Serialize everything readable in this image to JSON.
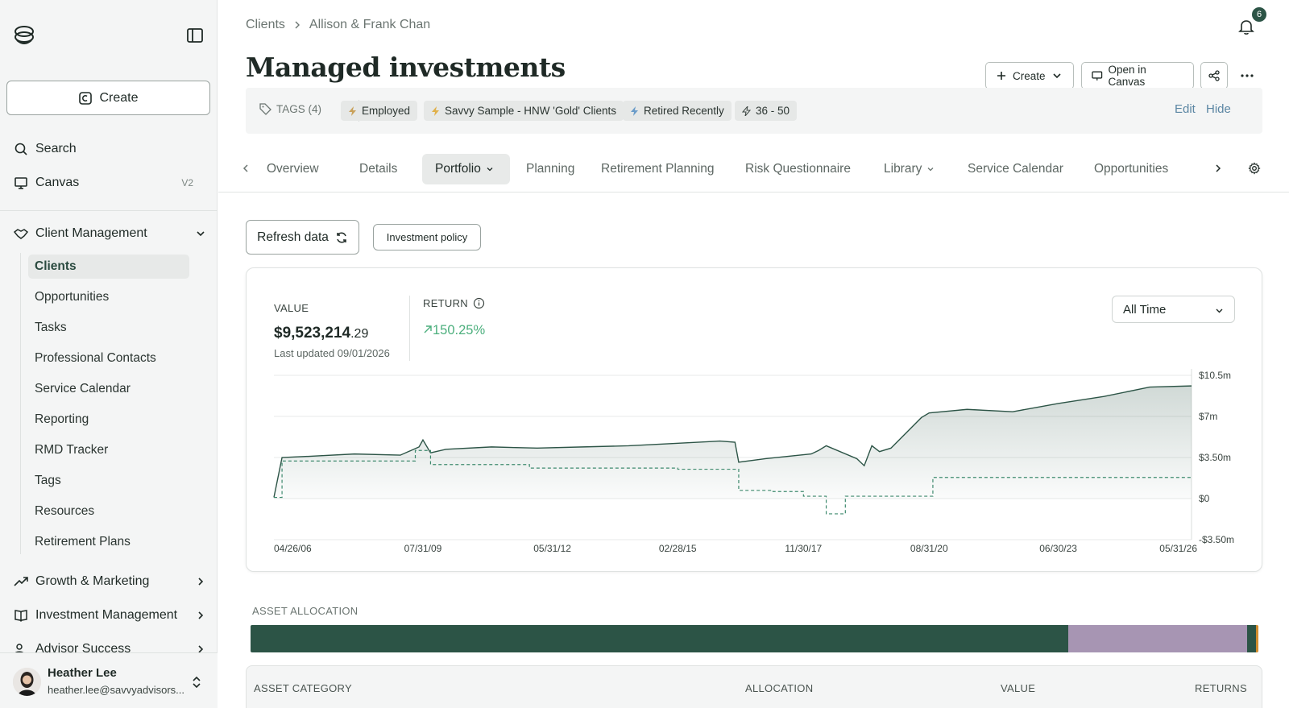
{
  "sidebar": {
    "create_label": "Create",
    "nav": [
      {
        "label": "Search",
        "icon": "search-icon"
      },
      {
        "label": "Canvas",
        "icon": "canvas-icon",
        "badge": "V2"
      }
    ],
    "client_management": {
      "label": "Client Management",
      "items": [
        {
          "label": "Clients",
          "active": true
        },
        {
          "label": "Opportunities"
        },
        {
          "label": "Tasks"
        },
        {
          "label": "Professional Contacts"
        },
        {
          "label": "Service Calendar"
        },
        {
          "label": "Reporting"
        },
        {
          "label": "RMD Tracker"
        },
        {
          "label": "Tags"
        },
        {
          "label": "Resources"
        },
        {
          "label": "Retirement Plans"
        }
      ]
    },
    "sections": [
      {
        "label": "Growth & Marketing",
        "icon": "trend-icon"
      },
      {
        "label": "Investment Management",
        "icon": "book-icon"
      },
      {
        "label": "Advisor Success",
        "icon": "users-icon"
      }
    ],
    "user": {
      "name": "Heather Lee",
      "email": "heather.lee@savvyadvisors..."
    }
  },
  "header": {
    "breadcrumb": [
      "Clients",
      "Allison & Frank Chan"
    ],
    "notifications": "6",
    "title": "Managed investments",
    "buttons": {
      "create": "Create",
      "canvas": "Open in Canvas"
    }
  },
  "tags": {
    "label": "TAGS (4)",
    "items": [
      "Employed",
      "Savvy Sample - HNW 'Gold' Clients",
      "Retired Recently",
      "36 - 50"
    ],
    "edit": "Edit",
    "hide": "Hide"
  },
  "tabs": [
    "Overview",
    "Details",
    "Portfolio",
    "Planning",
    "Retirement Planning",
    "Risk Questionnaire",
    "Library",
    "Service Calendar",
    "Opportunities"
  ],
  "active_tab": "Portfolio",
  "actions": {
    "refresh": "Refresh data",
    "policy": "Investment policy"
  },
  "summary": {
    "value_label": "VALUE",
    "value_main": "$9,523,214",
    "value_cents": ".29",
    "updated": "Last updated 09/01/2026",
    "return_label": "RETURN",
    "return_value": "150.25%",
    "range": "All Time"
  },
  "chart_data": {
    "type": "line",
    "x_ticks": [
      "04/26/06",
      "07/31/09",
      "05/31/12",
      "02/28/15",
      "11/30/17",
      "08/31/20",
      "06/30/23",
      "05/31/26"
    ],
    "y_ticks": [
      "$10.5m",
      "$7m",
      "$3.50m",
      "$0",
      "-$3.50m"
    ],
    "ylim": [
      -3.5,
      10.5
    ],
    "series": [
      {
        "style": "solid",
        "x": [
          "04/26/06",
          "06/30/06",
          "01/31/07",
          "01/31/08",
          "01/31/09",
          "06/30/09",
          "07/31/09",
          "09/30/09",
          "01/31/10",
          "01/31/11",
          "01/31/12",
          "01/31/13",
          "01/31/14",
          "01/31/15",
          "01/31/16",
          "05/31/16",
          "06/30/16",
          "01/31/17",
          "01/31/18",
          "03/31/18",
          "05/31/18",
          "01/31/19",
          "03/31/19",
          "05/31/19",
          "07/31/19",
          "10/31/19",
          "06/30/20",
          "08/31/20",
          "06/30/21",
          "06/30/22",
          "06/30/23",
          "06/30/24",
          "06/30/25",
          "05/31/26"
        ],
        "values": [
          0.1,
          3.5,
          3.6,
          3.8,
          3.7,
          4.4,
          5.0,
          3.9,
          4.2,
          4.4,
          4.3,
          4.4,
          4.5,
          4.7,
          4.9,
          4.8,
          3.1,
          3.4,
          3.8,
          4.1,
          4.5,
          3.4,
          2.8,
          4.5,
          4.0,
          4.3,
          6.9,
          7.3,
          7.6,
          7.4,
          8.1,
          8.7,
          9.5,
          9.6
        ]
      },
      {
        "style": "dashed",
        "x": [
          "04/26/06",
          "06/30/06",
          "03/31/09",
          "05/31/09",
          "09/30/09",
          "11/30/11",
          "02/28/15",
          "05/31/16",
          "06/30/16",
          "03/31/17",
          "11/30/17",
          "05/31/18",
          "10/31/18",
          "11/30/19",
          "09/30/20",
          "05/31/26"
        ],
        "values": [
          0.1,
          3.2,
          3.2,
          4.1,
          2.9,
          2.6,
          2.5,
          2.5,
          0.7,
          0.6,
          0.2,
          -1.3,
          0.2,
          0.2,
          1.8,
          1.8
        ]
      }
    ]
  },
  "allocation": {
    "label": "ASSET ALLOCATION",
    "segments": [
      {
        "share": 0.811,
        "color": "#2c5446"
      },
      {
        "share": 0.178,
        "color": "#a795b3"
      },
      {
        "share": 0.009,
        "color": "#2c5446"
      },
      {
        "share": 0.002,
        "color": "#d18d2e"
      }
    ]
  },
  "table": {
    "headers": [
      "ASSET CATEGORY",
      "ALLOCATION",
      "VALUE",
      "RETURNS"
    ]
  }
}
